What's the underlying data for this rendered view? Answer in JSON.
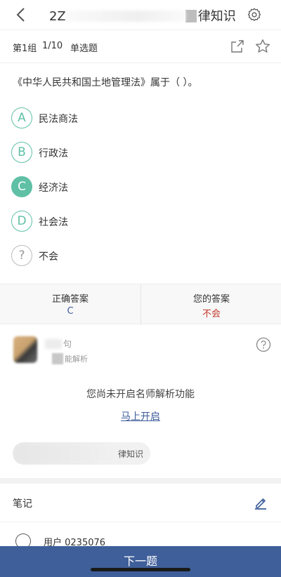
{
  "header": {
    "title_prefix": "2Z",
    "title_suffix": "律知识",
    "back_icon": "chevron-left-icon",
    "settings_icon": "gear-icon"
  },
  "subheader": {
    "group": "第1组",
    "progress": "1/10",
    "question_type": "单选题",
    "share_icon": "share-icon",
    "favorite_icon": "star-icon"
  },
  "question": {
    "text": "《中华人民共和国土地管理法》属于（ ）。",
    "options": [
      {
        "letter": "A",
        "text": "民法商法",
        "selected": false
      },
      {
        "letter": "B",
        "text": "行政法",
        "selected": false
      },
      {
        "letter": "C",
        "text": "经济法",
        "selected": true
      },
      {
        "letter": "D",
        "text": "社会法",
        "selected": false
      },
      {
        "letter": "?",
        "text": "不会",
        "selected": false
      }
    ]
  },
  "answer": {
    "correct_label": "正确答案",
    "correct_value": "C",
    "yours_label": "您的答案",
    "yours_value": "不会"
  },
  "teacher": {
    "name_partial": "句",
    "subtitle_partial": "能解析",
    "notice": "您尚未开启名师解析功能",
    "open_link": "马上开启",
    "tag_partial": "律知识",
    "help_icon": "question-circle-icon"
  },
  "notes": {
    "title": "笔记",
    "edit_icon": "pen-icon",
    "user": "用户 0235076"
  },
  "footer": {
    "next_label": "下一题"
  },
  "colors": {
    "accent_green": "#5fc0a6",
    "primary_blue": "#3f5f9a",
    "correct_blue": "#3d5c9a",
    "wrong_red": "#c0392b"
  }
}
